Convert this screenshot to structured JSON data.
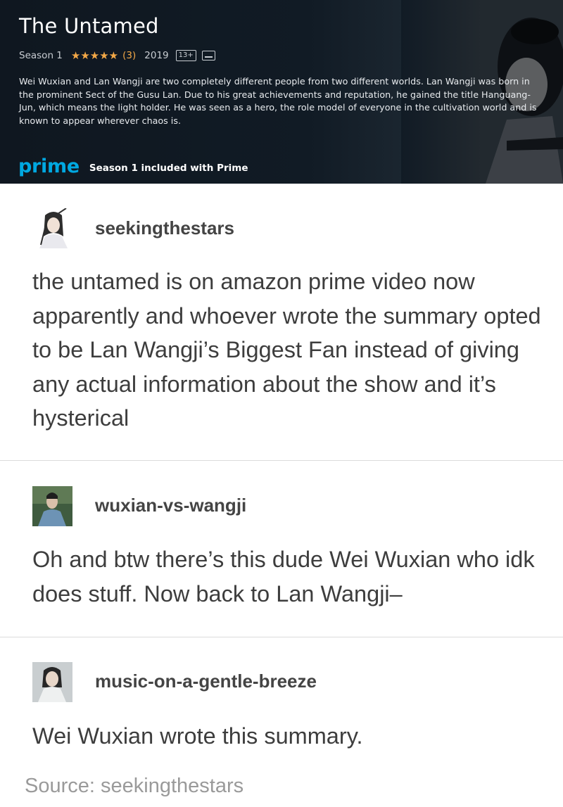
{
  "show": {
    "title": "The Untamed",
    "season": "Season 1",
    "stars": "★★★★★",
    "rating_count": "(3)",
    "year": "2019",
    "age_rating": "13+",
    "subtitles_icon": "subtitles-icon",
    "synopsis": "Wei Wuxian and Lan Wangji are two completely different people from two different worlds. Lan Wangji was born in the prominent Sect of the Gusu Lan. Due to his great achievements and reputation, he gained the title Hanguang-Jun, which means the light holder. He was seen as a hero, the role model of everyone in the cultivation world and is known to appear wherever chaos is.",
    "prime_logo": "prime",
    "prime_text": "Season 1 included with Prime",
    "colors": {
      "prime_blue": "#00a8e1",
      "star_orange": "#f3a847",
      "banner_bg": "#0f1720"
    }
  },
  "posts": [
    {
      "username": "seekingthestars",
      "body": "the untamed is on amazon prime video now apparently and whoever wrote the summary opted to be Lan Wangji’s Biggest Fan instead of giving any actual information about the show and it’s hysterical"
    },
    {
      "username": "wuxian-vs-wangji",
      "body": "Oh and btw there’s this dude Wei Wuxian who idk does stuff. Now back to Lan Wangji–"
    },
    {
      "username": "music-on-a-gentle-breeze",
      "body": "Wei Wuxian wrote this summary."
    }
  ],
  "source": "Source: seekingthestars"
}
